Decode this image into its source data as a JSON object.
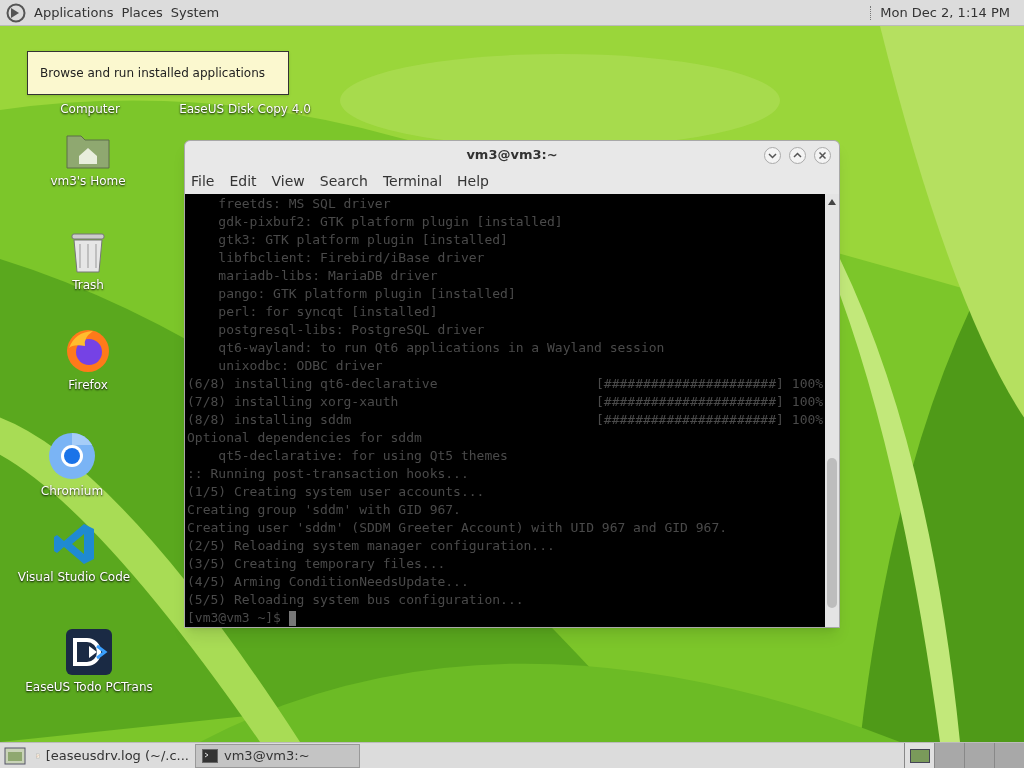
{
  "top_panel": {
    "menus": [
      {
        "label": "Applications"
      },
      {
        "label": "Places"
      },
      {
        "label": "System"
      }
    ],
    "clock": "Mon Dec 2, 1:14 PM"
  },
  "tooltip": "Browse and run installed applications",
  "desktop_icons": [
    {
      "kind": "covered",
      "label": "Computer"
    },
    {
      "kind": "covered",
      "label": "EaseUS Disk Copy 4.0"
    },
    {
      "kind": "home",
      "label": "vm3's Home"
    },
    {
      "kind": "trash",
      "label": "Trash"
    },
    {
      "kind": "firefox",
      "label": "Firefox"
    },
    {
      "kind": "chromium",
      "label": "Chromium"
    },
    {
      "kind": "vscode",
      "label": "Visual Studio Code"
    },
    {
      "kind": "pctrans",
      "label": "EaseUS Todo PCTrans"
    }
  ],
  "terminal": {
    "title": "vm3@vm3:~",
    "menus": [
      "File",
      "Edit",
      "View",
      "Search",
      "Terminal",
      "Help"
    ],
    "lines": [
      {
        "text": "    freetds: MS SQL driver"
      },
      {
        "text": "    gdk-pixbuf2: GTK platform plugin [installed]"
      },
      {
        "text": "    gtk3: GTK platform plugin [installed]"
      },
      {
        "text": "    libfbclient: Firebird/iBase driver"
      },
      {
        "text": "    mariadb-libs: MariaDB driver"
      },
      {
        "text": "    pango: GTK platform plugin [installed]"
      },
      {
        "text": "    perl: for syncqt [installed]"
      },
      {
        "text": "    postgresql-libs: PostgreSQL driver"
      },
      {
        "text": "    qt6-wayland: to run Qt6 applications in a Wayland session"
      },
      {
        "text": "    unixodbc: ODBC driver"
      },
      {
        "text": "(6/8) installing qt6-declarative",
        "bar": "[######################]",
        "percent": "100%"
      },
      {
        "text": "(7/8) installing xorg-xauth",
        "bar": "[######################]",
        "percent": "100%"
      },
      {
        "text": "(8/8) installing sddm",
        "bar": "[######################]",
        "percent": "100%"
      },
      {
        "text": "Optional dependencies for sddm"
      },
      {
        "text": "    qt5-declarative: for using Qt5 themes"
      },
      {
        "text": ":: Running post-transaction hooks..."
      },
      {
        "text": "(1/5) Creating system user accounts..."
      },
      {
        "text": "Creating group 'sddm' with GID 967."
      },
      {
        "text": "Creating user 'sddm' (SDDM Greeter Account) with UID 967 and GID 967."
      },
      {
        "text": "(2/5) Reloading system manager configuration..."
      },
      {
        "text": "(3/5) Creating temporary files..."
      },
      {
        "text": "(4/5) Arming ConditionNeedsUpdate..."
      },
      {
        "text": "(5/5) Reloading system bus configuration..."
      }
    ],
    "prompt": "[vm3@vm3 ~]$"
  },
  "taskbar": {
    "tasks": [
      {
        "kind": "editor",
        "label": "[easeusdrv.log (~/.c...",
        "selected": false
      },
      {
        "kind": "terminal",
        "label": "vm3@vm3:~",
        "selected": true
      }
    ],
    "workspaces": [
      {
        "selected": true
      },
      {
        "selected": false
      },
      {
        "selected": false
      },
      {
        "selected": false
      }
    ]
  }
}
